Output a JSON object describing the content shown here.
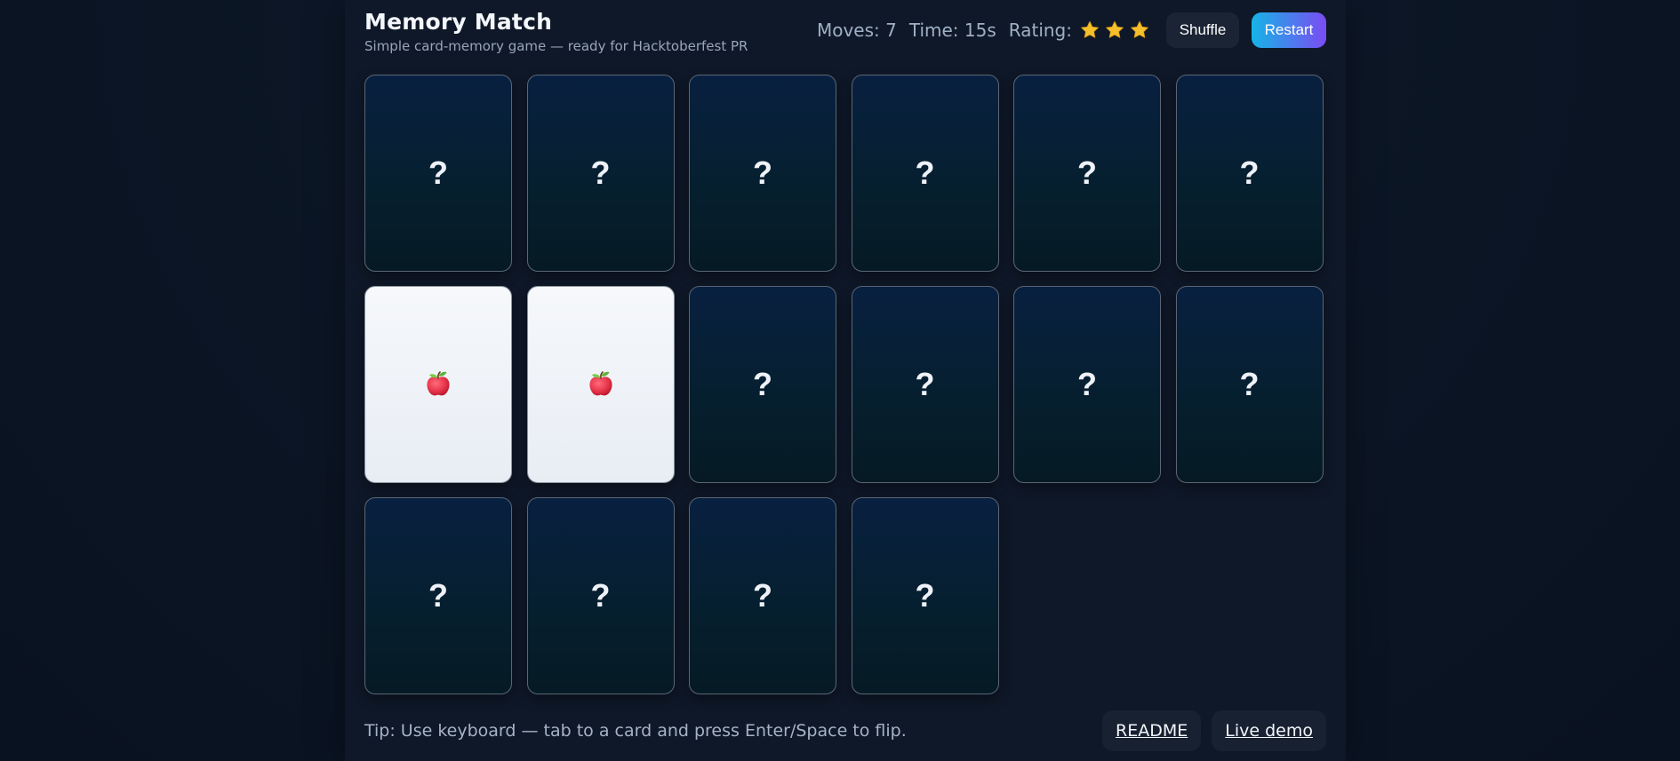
{
  "header": {
    "title": "Memory Match",
    "subtitle": "Simple card-memory game — ready for Hacktoberfest PR"
  },
  "stats": {
    "moves_label": "Moves: 7",
    "time_label": "Time: 15s",
    "rating_label": "Rating:",
    "rating_stars": 3,
    "rating_max": 3
  },
  "controls": {
    "shuffle_label": "Shuffle",
    "restart_label": "Restart"
  },
  "cards": [
    {
      "state": "hidden",
      "label": "?"
    },
    {
      "state": "hidden",
      "label": "?"
    },
    {
      "state": "hidden",
      "label": "?"
    },
    {
      "state": "hidden",
      "label": "?"
    },
    {
      "state": "hidden",
      "label": "?"
    },
    {
      "state": "hidden",
      "label": "?"
    },
    {
      "state": "revealed",
      "icon": "apple-icon"
    },
    {
      "state": "revealed",
      "icon": "apple-icon"
    },
    {
      "state": "hidden",
      "label": "?"
    },
    {
      "state": "hidden",
      "label": "?"
    },
    {
      "state": "hidden",
      "label": "?"
    },
    {
      "state": "hidden",
      "label": "?"
    },
    {
      "state": "hidden",
      "label": "?"
    },
    {
      "state": "hidden",
      "label": "?"
    },
    {
      "state": "hidden",
      "label": "?"
    },
    {
      "state": "hidden",
      "label": "?"
    }
  ],
  "footer": {
    "tip": "Tip: Use keyboard — tab to a card and press Enter/Space to flip.",
    "readme_label": "README",
    "live_demo_label": "Live demo"
  },
  "colors": {
    "accent_start": "#16b4e6",
    "accent_end": "#7b4cf3",
    "star": "#f5c02c"
  }
}
